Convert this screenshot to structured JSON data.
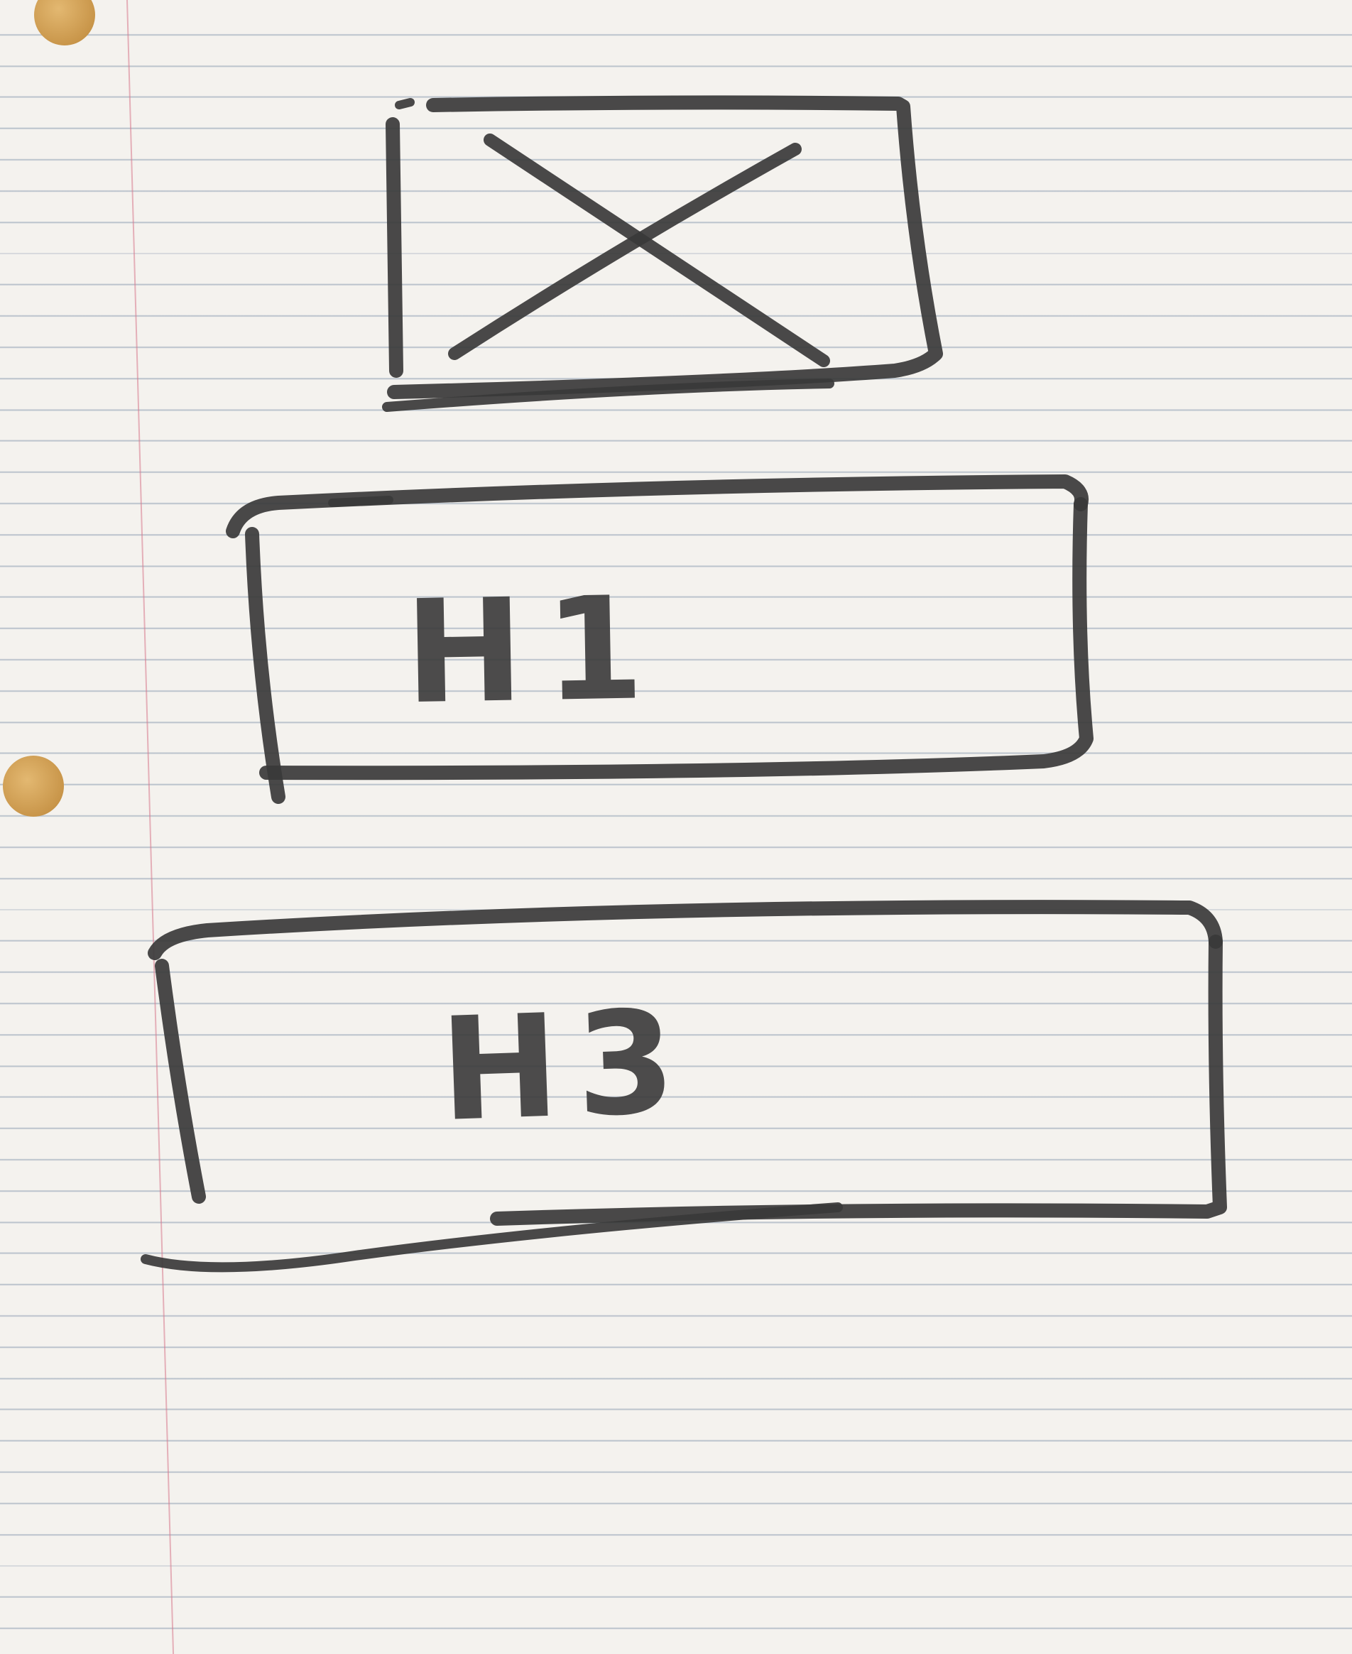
{
  "diagram": {
    "heading_one_block": {
      "label": "H1"
    },
    "heading_three_block": {
      "label": "H3"
    }
  },
  "colors": {
    "paper": "#f4f2ee",
    "rule_line": "#788ca5",
    "margin_line": "#d7788c",
    "marker_ink": "#3a3a3a",
    "punch_hole": "#c9964a"
  },
  "icons": {
    "image_placeholder": "image-placeholder-icon",
    "image_cross": "x-cross-icon"
  }
}
